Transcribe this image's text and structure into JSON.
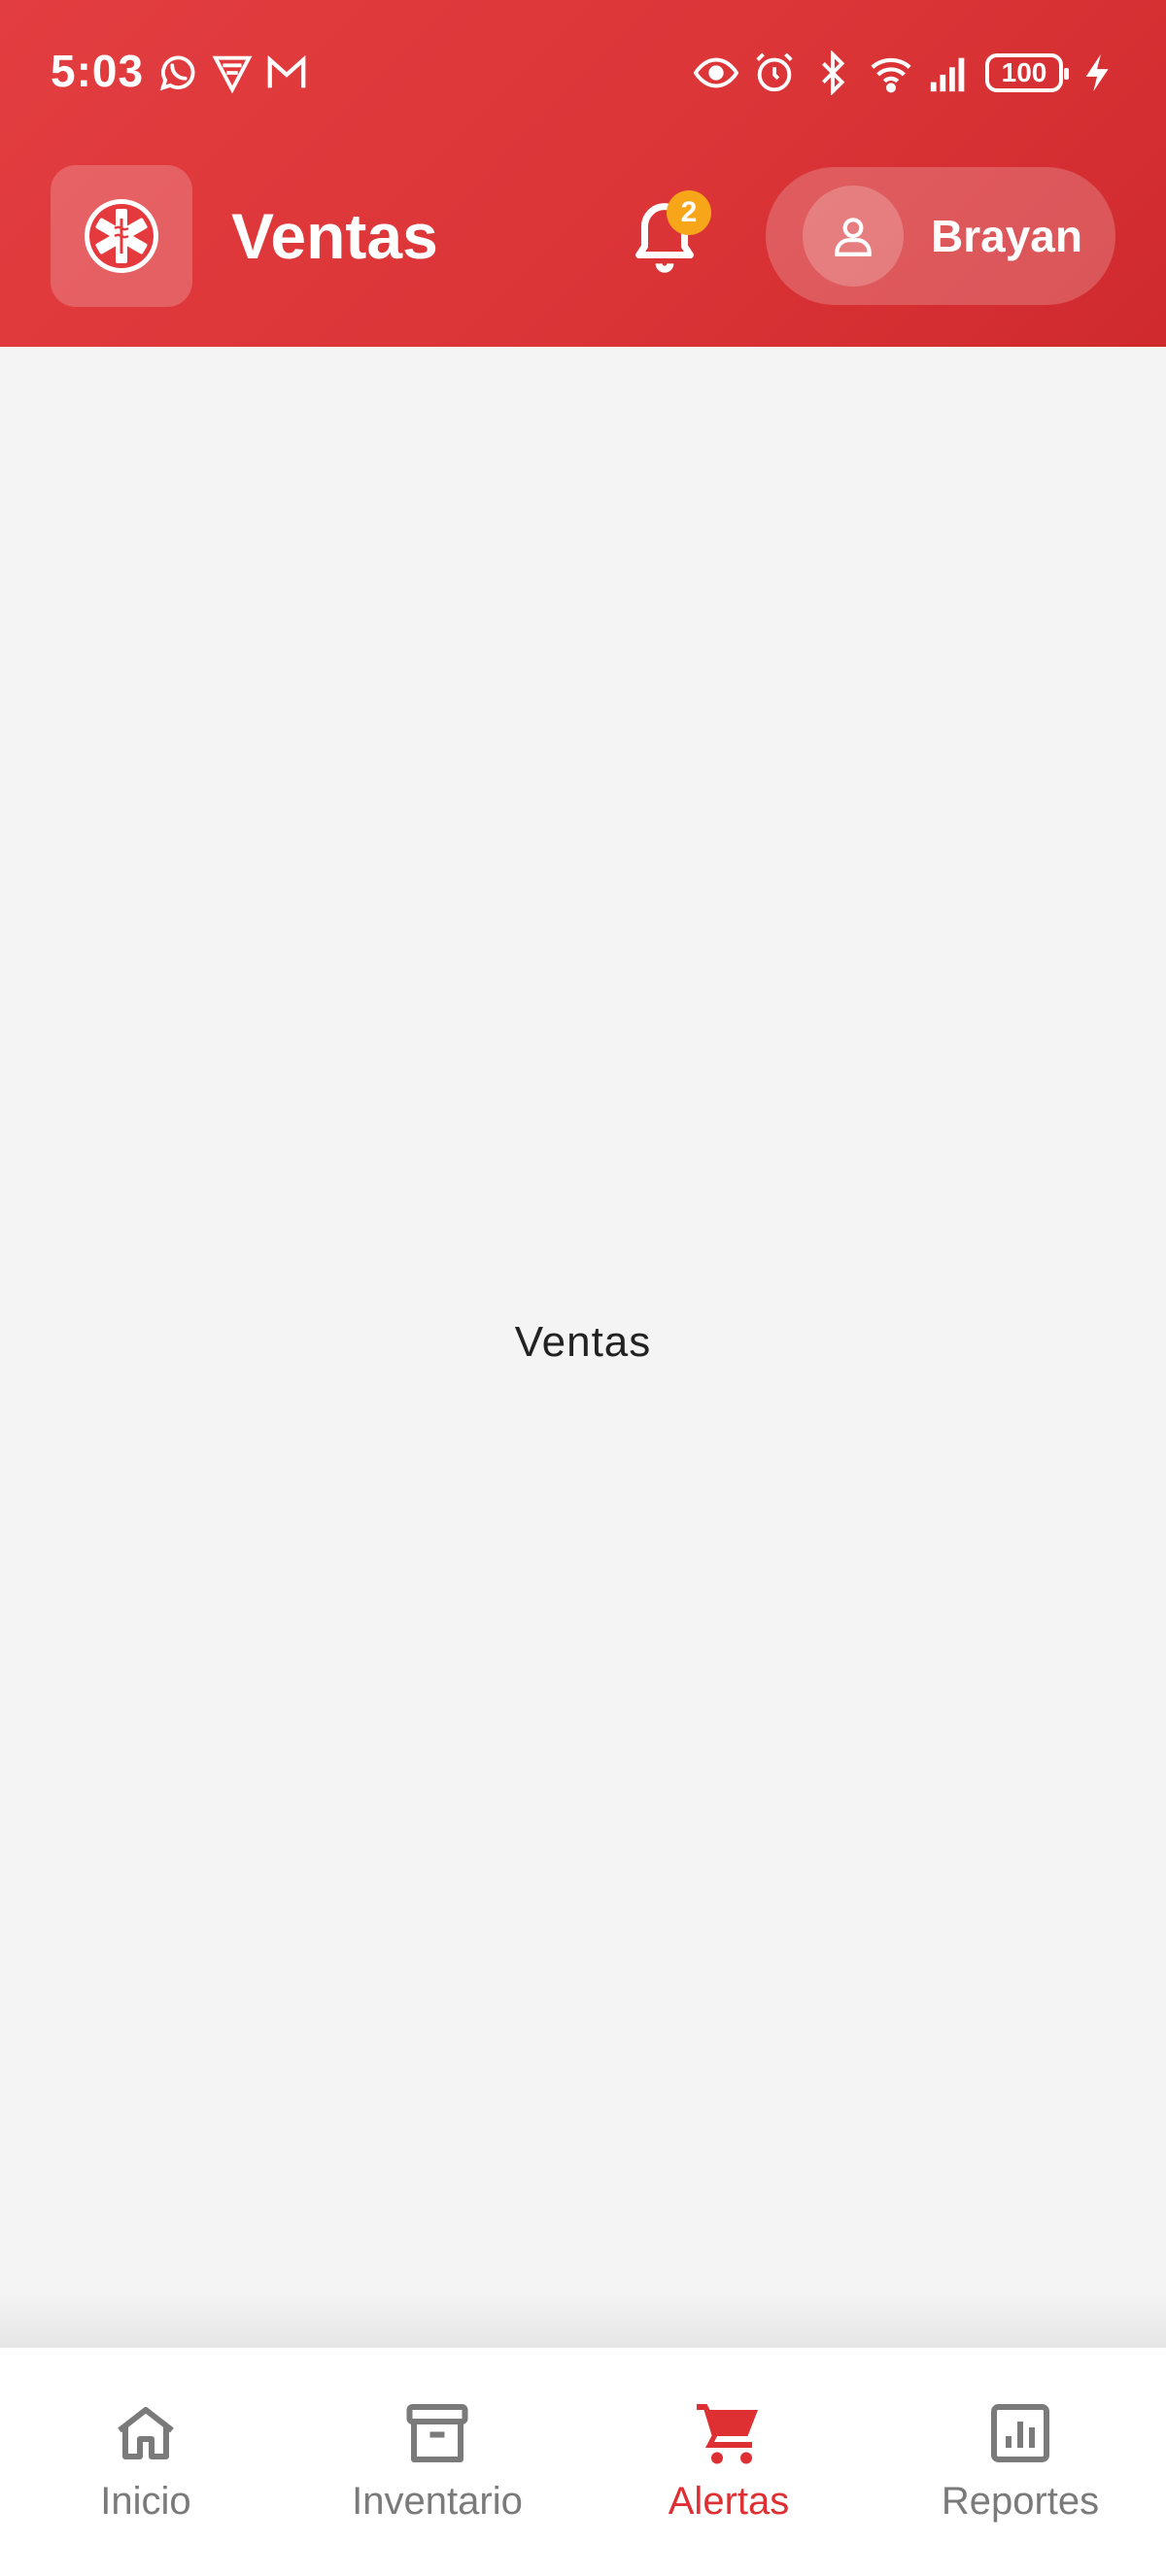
{
  "status_bar": {
    "time": "5:03",
    "battery": "100",
    "left_icons": [
      "whatsapp-icon",
      "shield-icon",
      "gmail-icon"
    ],
    "right_icons": [
      "eye-icon",
      "alarm-icon",
      "bluetooth-icon",
      "wifi-icon",
      "signal-icon",
      "battery-icon",
      "charging-icon"
    ]
  },
  "header": {
    "title": "Ventas",
    "notification_count": "2",
    "user_name": "Brayan",
    "colors": {
      "primary": "#dc3538",
      "badge": "#f7a619"
    }
  },
  "main": {
    "placeholder_text": "Ventas"
  },
  "bottom_nav": {
    "items": [
      {
        "label": "Inicio",
        "icon": "home-icon",
        "active": false
      },
      {
        "label": "Inventario",
        "icon": "archive-icon",
        "active": false
      },
      {
        "label": "Alertas",
        "icon": "cart-icon",
        "active": true
      },
      {
        "label": "Reportes",
        "icon": "report-chart-icon",
        "active": false
      }
    ],
    "colors": {
      "active": "#de2f33",
      "inactive": "#7a7a7a"
    }
  }
}
